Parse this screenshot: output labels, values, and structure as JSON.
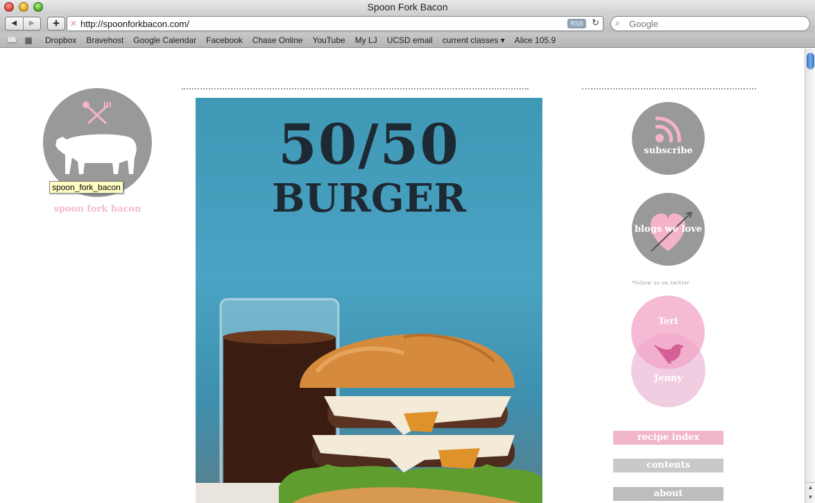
{
  "window": {
    "title": "Spoon Fork Bacon"
  },
  "toolbar": {
    "back": "◀",
    "forward": "▶",
    "add": "+",
    "url": "http://spoonforkbacon.com/",
    "rss": "RSS",
    "reload": "↻",
    "search_placeholder": "Google"
  },
  "bookmarks": {
    "items": [
      "Dropbox",
      "Bravehost",
      "Google Calendar",
      "Facebook",
      "Chase Online",
      "YouTube",
      "My LJ",
      "UCSD email",
      "current classes ▾",
      "Alice 105.9"
    ]
  },
  "site": {
    "logo_tooltip": "spoon_fork_bacon",
    "logo_text": "spoon fork bacon",
    "hero": {
      "line1": "50/50",
      "line2": "BURGER"
    },
    "subscribe": "subscribe",
    "blogs": "blogs we love",
    "follow_note": "*follow us on twitter",
    "teri": "Teri",
    "jenny": "Jenny",
    "nav": {
      "recipe_index": "recipe index",
      "contents": "contents",
      "about": "about"
    }
  },
  "colors": {
    "pink": "#f2b6cb",
    "gray_circle": "#999999",
    "hero_blue": "#4aa3c2"
  }
}
